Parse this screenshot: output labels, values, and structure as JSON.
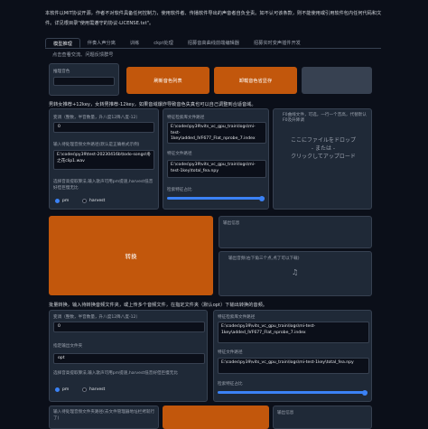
{
  "notice": "本软件以MIT协议开源，作者不对软件具备任何控制力，使用软件者、传播软件导出的声音者自负全责。如不认可该条款，则不能使用或引用软件包内任何代码和文件。详见根目录\"使用需遵守的协议-LICENSE.txt\"。",
  "tabs": [
    "模型推理",
    "伴奏人声分离",
    "训练",
    "ckpt处理",
    "招募音高曲线前端编辑器",
    "招募实时变声插件开发"
  ],
  "tab_row2": "点击查看交流、问题反馈群号",
  "speaker": {
    "label": "推理音色",
    "refresh": "刷新音色列表",
    "unload": "卸载音色省显存"
  },
  "hint": "男转女推荐+12key，女转男推荐-12key，如果音域爆炸导致音色失真也可以自己调整到合适音域。",
  "single": {
    "transpose_label": "变调（整数，半音数量，升八度12降八度-12）",
    "transpose_value": "0",
    "input_label": "输入待处理音频文件路径(默认是正确格式示例)",
    "input_value": "E:\\codes\\py39\\test-20230416b\\todo-songs\\冬之花clip1.wav",
    "f0_label": "选择音高提取算法,输入歌声可用pm提速,harvest低音好但巨慢无比",
    "f0_options": [
      "pm",
      "harvest"
    ],
    "index_label": "特征检索库文件路径",
    "index_value": "E:\\codes\\py39\\vits_vc_gpu_train\\logs\\mi-test-1key\\added_IVF677_Flat_nprobe_7.index",
    "feat_label": "特征文件路径",
    "feat_value": "E:\\codes\\py39\\vits_vc_gpu_train\\logs\\mi-test-1key\\total_fea.npy",
    "ratio_label": "检索特征占比",
    "ratio_value": 1,
    "f0_file_label": "F0曲线文件，可选，一行一个音高，代替默认F0及升降调",
    "drop_text": [
      "ここにファイルをドロップ",
      "- または -",
      "クリックしてアップロード"
    ],
    "convert": "转换",
    "output_info": "输出信息",
    "output_audio": "输出音频(右下角三个点,点了可以下载)"
  },
  "batch": {
    "hint": "批量转换，输入待转换音频文件夹，或上传多个音频文件，在指定文件夹（默认opt）下输出转换的音频。",
    "transpose_label": "变调（整数，半音数量，升八度12降八度-12）",
    "transpose_value": "0",
    "outdir_label": "指定输出文件夹",
    "outdir_value": "opt",
    "f0_label": "选择音高提取算法,输入歌声可用pm提速,harvest低音好但巨慢无比",
    "f0_options": [
      "pm",
      "harvest"
    ],
    "index_label": "特征检索库文件路径",
    "index_value": "E:\\codes\\py39\\vits_vc_gpu_train\\logs\\mi-test-1key\\added_IVF677_Flat_nprobe_7.index",
    "feat_label": "特征文件路径",
    "feat_value": "E:\\codes\\py39\\vits_vc_gpu_train\\logs\\mi-test-1key\\total_fea.npy",
    "ratio_label": "检索特征占比",
    "ratio_value": 1,
    "dir_label": "输入待处理音频文件夹路径(去文件管理器地址栏拷就行了)",
    "output_info": "输出信息"
  },
  "colors": {
    "accent": "#c2570c",
    "slider": "#3b82f6"
  }
}
